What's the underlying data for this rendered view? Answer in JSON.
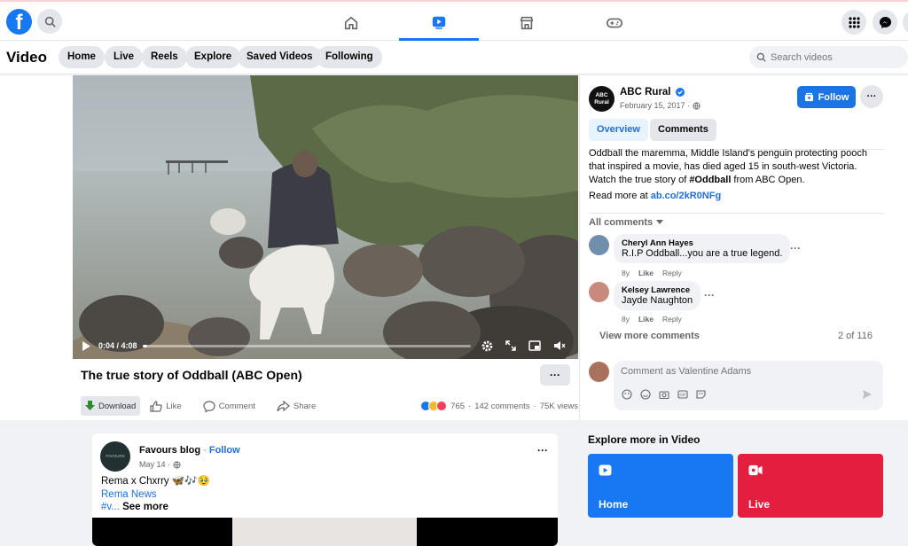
{
  "colors": {
    "brand": "#1877f2",
    "link": "#216fdb",
    "follow": "#1b74e4",
    "live": "#e41e3f",
    "download": "#2e8b2e"
  },
  "header": {
    "logo": "f",
    "nav_icons": [
      "home-icon",
      "video-icon",
      "marketplace-icon",
      "gaming-icon"
    ],
    "right_icons": [
      "menu-grid-icon",
      "messenger-icon"
    ]
  },
  "subnav": {
    "title": "Video",
    "pills": [
      "Home",
      "Live",
      "Reels",
      "Explore",
      "Saved Videos",
      "Following"
    ],
    "search_placeholder": "Search videos"
  },
  "video": {
    "time": "0:04 / 4:08",
    "progress": 0.015,
    "title": "The true story of Oddball (ABC Open)",
    "actions": [
      "Download",
      "Like",
      "Comment",
      "Share"
    ],
    "reaction_count": "765",
    "comments_count": "142 comments",
    "views": "75K views"
  },
  "page": {
    "avatar_text": "ABC Rural",
    "name": "ABC Rural",
    "date": "February 15, 2017 ·",
    "follow_label": "Follow",
    "tabs": [
      "Overview",
      "Comments"
    ],
    "desc_before": "Oddball the maremma, Middle Island's penguin protecting pooch that inspired a movie, has died aged 15 in south-west Victoria. Watch the true story of ",
    "desc_hashtag": "#Oddball",
    "desc_after": " from ABC Open.",
    "read_more_label": "Read more at ",
    "read_more_link": "ab.co/2kR0NFg"
  },
  "comments": {
    "filter": "All comments",
    "items": [
      {
        "name": "Cheryl Ann Hayes",
        "text": "R.I.P Oddball...you are a true legend.",
        "meta": [
          "8y",
          "Like",
          "Reply"
        ]
      },
      {
        "name": "Kelsey Lawrence",
        "text": "Jayde Naughton",
        "meta": [
          "8y",
          "Like",
          "Reply"
        ]
      }
    ],
    "view_more": "View more comments",
    "count": "2 of 116",
    "input_placeholder": "Comment as Valentine Adams"
  },
  "feed": {
    "avatar_text": "FAVOURS BLOG",
    "name": "Favours blog",
    "dot": " · ",
    "follow": "Follow",
    "date": "May 14 ·",
    "line1": "Rema x Chxrry 🦋🎶🥹",
    "line2": "Rema News",
    "line3a": "#v...",
    "line3b": " See more"
  },
  "explore": {
    "title": "Explore more in Video",
    "cards": [
      {
        "label": "Home"
      },
      {
        "label": "Live"
      }
    ]
  }
}
